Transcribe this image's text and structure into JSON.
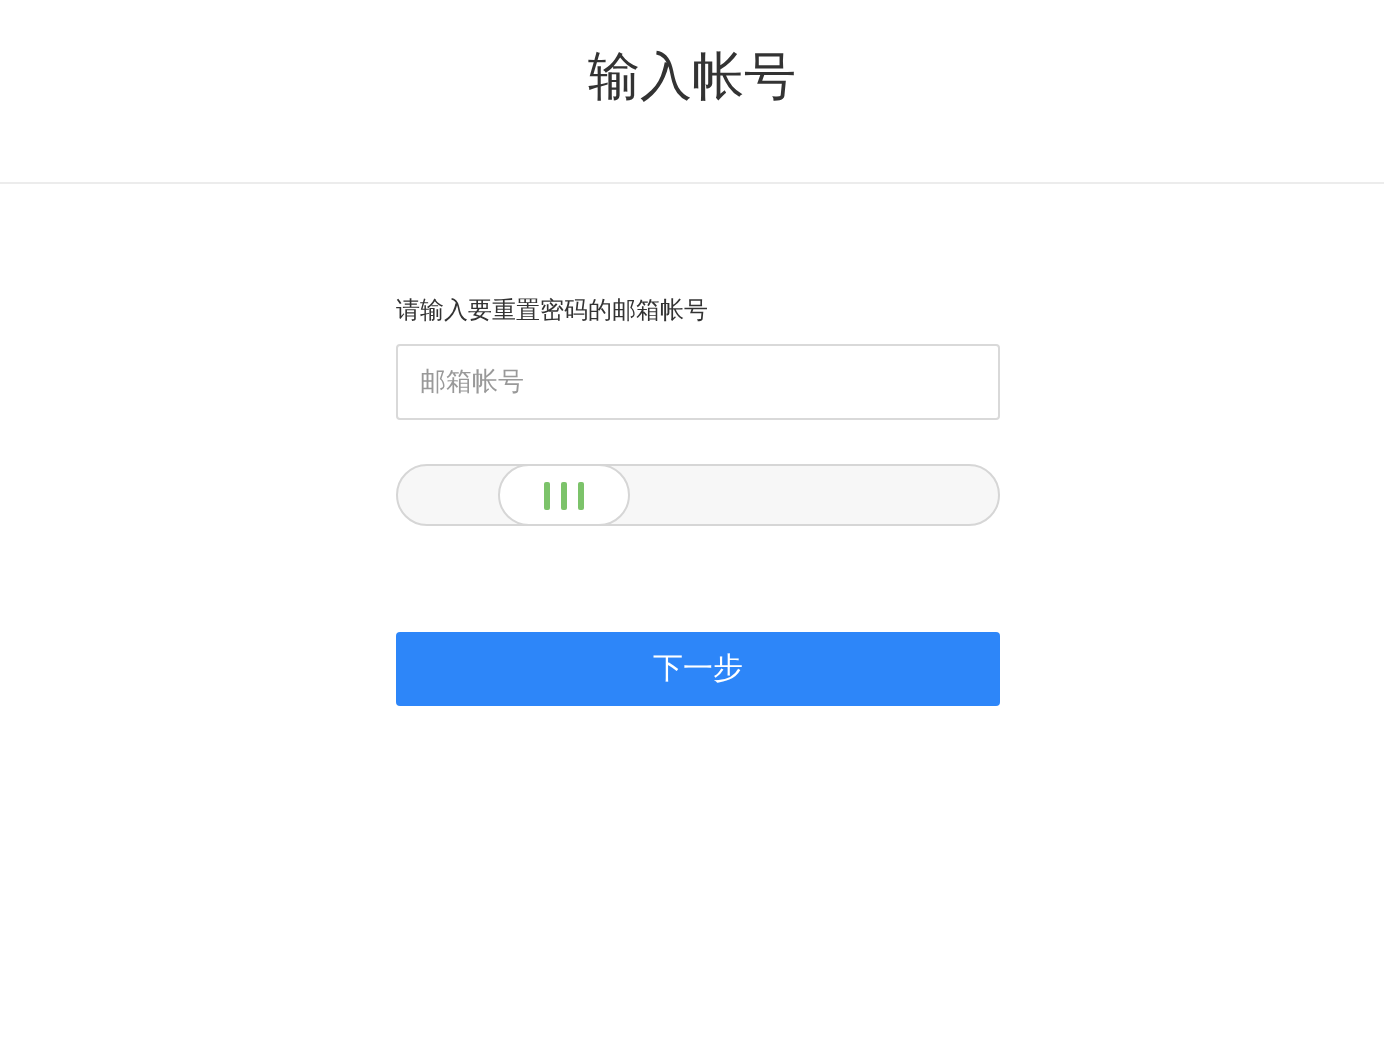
{
  "header": {
    "title": "输入帐号"
  },
  "form": {
    "label": "请输入要重置密码的邮箱帐号",
    "email_field": {
      "placeholder": "邮箱帐号"
    },
    "slider": {
      "level": 0.21
    },
    "next_button": "下一步"
  }
}
